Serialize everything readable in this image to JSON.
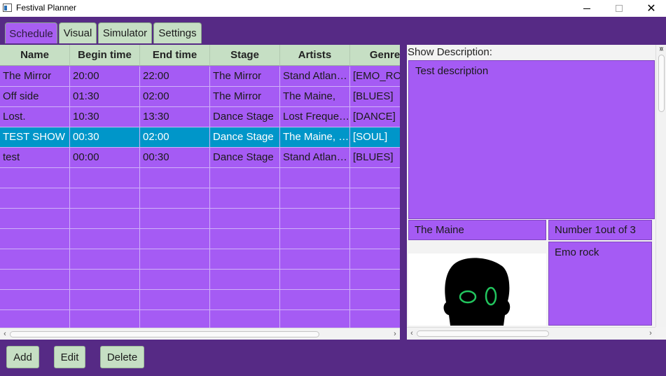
{
  "window": {
    "title": "Festival Planner"
  },
  "tabs": [
    {
      "label": "Schedule",
      "active": true
    },
    {
      "label": "Visual",
      "active": false
    },
    {
      "label": "Simulator",
      "active": false
    },
    {
      "label": "Settings",
      "active": false
    }
  ],
  "table": {
    "columns": [
      "Name",
      "Begin time",
      "End time",
      "Stage",
      "Artists",
      "Genre"
    ],
    "rows": [
      [
        "The Mirror",
        "20:00",
        "22:00",
        "The Mirror",
        "Stand Atlan…",
        "[EMO_RO("
      ],
      [
        "Off side",
        "01:30",
        "02:00",
        "The Mirror",
        "The Maine,",
        "[BLUES]"
      ],
      [
        "Lost.",
        "10:30",
        "13:30",
        "Dance Stage",
        "Lost Freque…",
        "[DANCE]"
      ],
      [
        "TEST SHOW",
        "00:30",
        "02:00",
        "Dance Stage",
        "The Maine, …",
        "[SOUL]"
      ],
      [
        "test",
        "00:00",
        "00:30",
        "Dance Stage",
        "Stand Atlan…",
        "[BLUES]"
      ]
    ],
    "selected_row": 3,
    "empty_rows": 8
  },
  "detail": {
    "description_label": "Show Description:",
    "description": "Test description",
    "artist_name": "The Maine",
    "artist_number": "Number 1out of 3",
    "genre": "Emo rock",
    "artist_image_icon": "artist-silhouette-icon"
  },
  "buttons": {
    "add": "Add",
    "edit": "Edit",
    "delete": "Delete"
  },
  "colors": {
    "background": "#562a85",
    "panel": "#a55bf4",
    "header": "#c6dfc4",
    "selection": "#0096c9"
  }
}
